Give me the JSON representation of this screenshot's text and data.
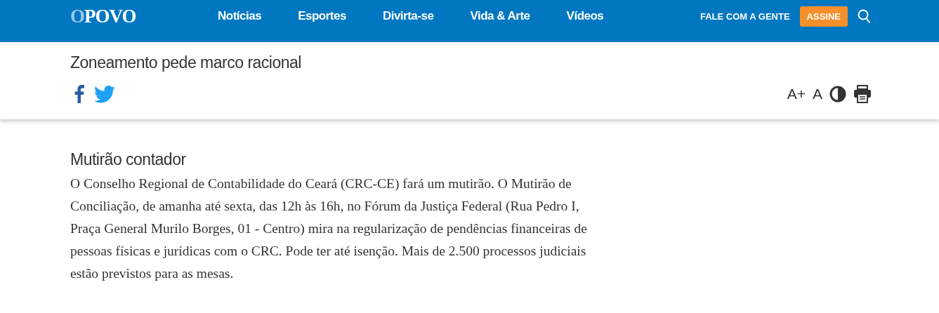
{
  "header": {
    "logo": {
      "first": "O",
      "rest": "POVO"
    },
    "nav": [
      {
        "label": "Notícias"
      },
      {
        "label": "Esportes"
      },
      {
        "label": "Divirta-se"
      },
      {
        "label": "Vida & Arte"
      },
      {
        "label": "Vídeos"
      }
    ],
    "contact_link": "FALE COM A GENTE",
    "subscribe_button": "ASSINE"
  },
  "article_bar": {
    "title": "Zoneamento pede marco racional",
    "font_controls": {
      "increase": "A+",
      "decrease": "A"
    }
  },
  "section": {
    "heading": "Mutirão contador",
    "paragraph": "O Conselho Regional de Contabilidade do Ceará (CRC-CE) fará um mutirão. O Mutirão de Conciliação, de amanha até sexta, das 12h às 16h, no Fórum da Justiça Federal (Rua Pedro I, Praça General Murilo Borges, 01 - Centro) mira na regularização de pendências financeiras de pessoas físicas e jurídicas com o CRC. Pode ter até isenção. Mais de 2.500 processos judiciais estão previstos para as mesas."
  }
}
